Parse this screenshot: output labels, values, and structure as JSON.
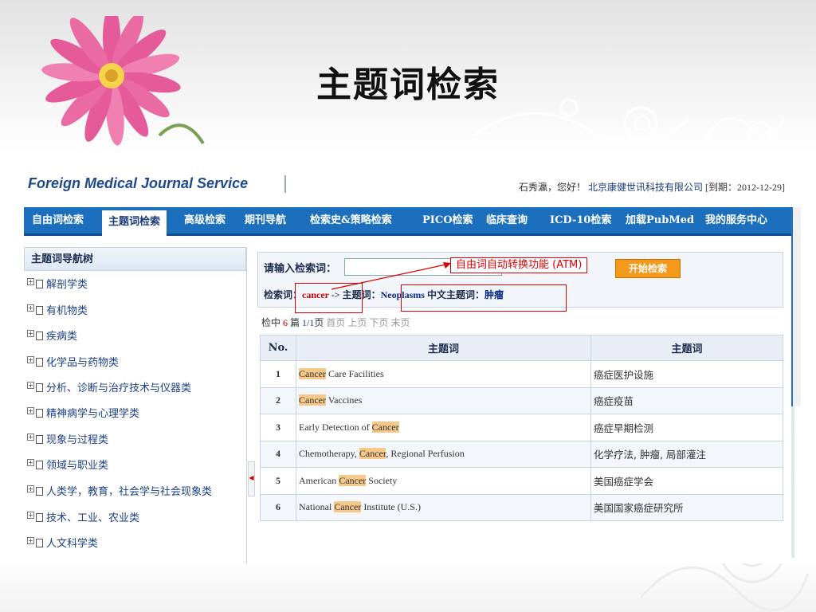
{
  "slide": {
    "title": "主题词检索"
  },
  "header": {
    "logo": "Foreign Medical Journal Service",
    "greeting": "石秀瀛，您好！",
    "company": "北京康健世讯科技有限公司",
    "expiry": "[到期：2012-12-29]"
  },
  "nav": {
    "items": [
      {
        "label": "自由词检索"
      },
      {
        "label": "主题词检索",
        "active": true
      },
      {
        "label": "高级检索"
      },
      {
        "label": "期刊导航"
      },
      {
        "label": "检索史&策略检索"
      },
      {
        "label": "PICO检索"
      },
      {
        "label": "临床查询"
      },
      {
        "label": "ICD-10检索"
      },
      {
        "label": "加载PubMed"
      },
      {
        "label": "我的服务中心"
      }
    ]
  },
  "sidebar": {
    "title": "主题词导航树",
    "items": [
      {
        "label": "解剖学类"
      },
      {
        "label": "有机物类"
      },
      {
        "label": "疾病类"
      },
      {
        "label": "化学品与药物类"
      },
      {
        "label": "分析、诊断与治疗技术与仪器类"
      },
      {
        "label": "精神病学与心理学类"
      },
      {
        "label": "现象与过程类"
      },
      {
        "label": "领域与职业类"
      },
      {
        "label": "人类学，教育，社会学与社会现象类"
      },
      {
        "label": "技术、工业、农业类"
      },
      {
        "label": "人文科学类"
      }
    ]
  },
  "search": {
    "label": "请输入检索词：",
    "value": "",
    "button": "开始检索",
    "annotation": "自由词自动转换功能 (ATM)",
    "term_label": "检索词：",
    "term_value": "cancer",
    "arrow_text": "->",
    "mesh_label": "主题词：",
    "mesh_value": "Neoplasms",
    "cn_label": "中文主题词：",
    "cn_value": "肿瘤"
  },
  "results": {
    "prefix": "检中",
    "count": "6",
    "unit": "篇",
    "page": "1/1",
    "page_unit": "页",
    "first": "首页",
    "prev": "上页",
    "next": "下页",
    "last": "末页",
    "columns": [
      "No.",
      "主题词",
      "主题词"
    ],
    "rows": [
      {
        "no": "1",
        "pre": "",
        "hl": "Cancer",
        "post": " Care Facilities",
        "cn": "癌症医护设施"
      },
      {
        "no": "2",
        "pre": "",
        "hl": "Cancer",
        "post": " Vaccines",
        "cn": "癌症疫苗"
      },
      {
        "no": "3",
        "pre": "Early Detection of ",
        "hl": "Cancer",
        "post": "",
        "cn": "癌症早期检测"
      },
      {
        "no": "4",
        "pre": "Chemotherapy, ",
        "hl": "Cancer",
        "post": ", Regional Perfusion",
        "cn": "化学疗法, 肿瘤, 局部灌注"
      },
      {
        "no": "5",
        "pre": "American ",
        "hl": "Cancer",
        "post": " Society",
        "cn": "美国癌症学会"
      },
      {
        "no": "6",
        "pre": "National ",
        "hl": "Cancer",
        "post": " Institute (U.S.)",
        "cn": "美国国家癌症研究所"
      }
    ]
  }
}
